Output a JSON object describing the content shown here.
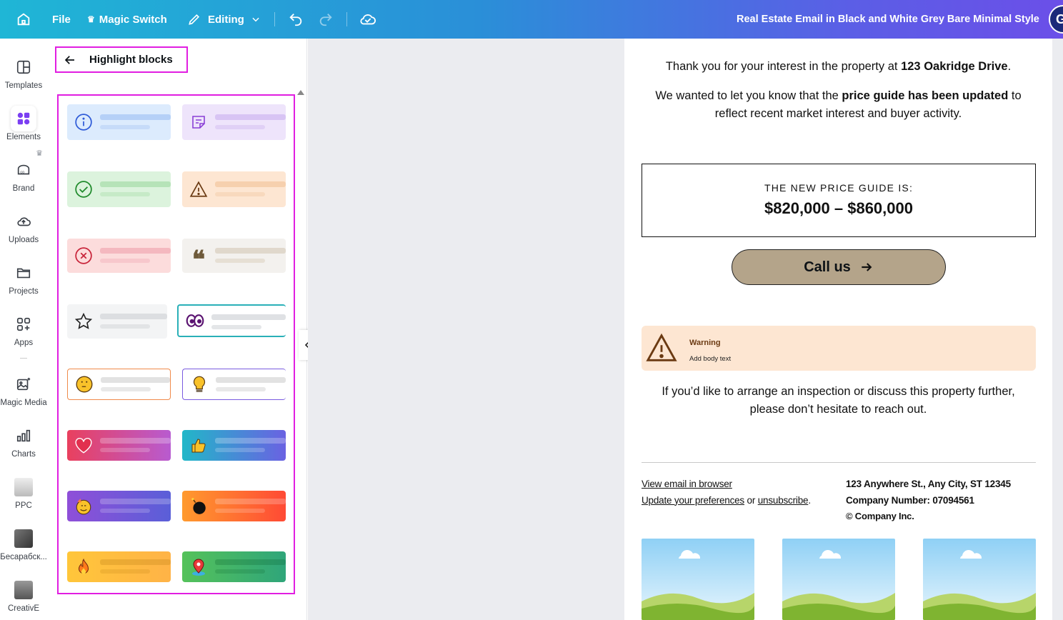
{
  "topbar": {
    "file": "File",
    "magic_switch": "Magic Switch",
    "editing": "Editing",
    "title": "Real Estate Email in Black and White Grey Bare Minimal Style",
    "avatar_initial": "G"
  },
  "sidebar": {
    "items": [
      {
        "label": "Templates"
      },
      {
        "label": "Elements"
      },
      {
        "label": "Brand"
      },
      {
        "label": "Uploads"
      },
      {
        "label": "Projects"
      },
      {
        "label": "Apps"
      },
      {
        "label": "Magic Media"
      },
      {
        "label": "Charts"
      },
      {
        "label": "PPC"
      },
      {
        "label": "Бесарабск..."
      },
      {
        "label": "CreativE"
      }
    ]
  },
  "panel": {
    "title": "Highlight blocks",
    "blocks": [
      {
        "icon": "info-icon"
      },
      {
        "icon": "note-icon"
      },
      {
        "icon": "check-circle-icon"
      },
      {
        "icon": "warning-icon"
      },
      {
        "icon": "error-circle-icon"
      },
      {
        "icon": "quote-icon"
      },
      {
        "icon": "star-icon"
      },
      {
        "icon": "eyes-icon"
      },
      {
        "icon": "thinking-emoji-icon"
      },
      {
        "icon": "lightbulb-icon"
      },
      {
        "icon": "heart-icon"
      },
      {
        "icon": "thumbs-up-icon"
      },
      {
        "icon": "party-emoji-icon"
      },
      {
        "icon": "bomb-icon"
      },
      {
        "icon": "fire-icon"
      },
      {
        "icon": "map-pin-icon"
      }
    ]
  },
  "email": {
    "intro_a": "Thank you for your interest in the property at ",
    "intro_b": "123 Oakridge Drive",
    "intro_c": ".",
    "update_a": "We wanted to let you know that the ",
    "update_b": "price guide has been updated",
    "update_c": " to",
    "update_line2": "reflect recent market interest and buyer activity.",
    "price_label": "THE NEW PRICE GUIDE IS:",
    "price_value": "$820,000 – $860,000",
    "call_button": "Call us",
    "warning_title": "Warning",
    "warning_body": "Add body text",
    "closing_line1": "If you’d like to arrange an inspection or discuss this property further,",
    "closing_line2": "please don’t hesitate to reach out.",
    "footer": {
      "view_browser": "View email in browser",
      "update_prefs": "Update your preferences",
      "or": " or ",
      "unsubscribe": "unsubscribe",
      "period": ".",
      "address": "123 Anywhere St., Any City, ST 12345",
      "company_number": "Company Number: 07094561",
      "copyright": "© Company Inc."
    }
  }
}
